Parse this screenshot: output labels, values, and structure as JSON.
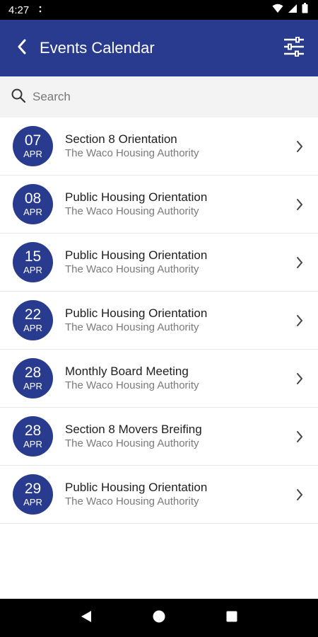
{
  "status_bar": {
    "time": "4:27",
    "notification_icon": "dots-icon",
    "icons": [
      "wifi-icon",
      "signal-icon",
      "battery-icon"
    ]
  },
  "app_bar": {
    "title": "Events Calendar",
    "back_icon": "back-arrow-icon",
    "filter_icon": "filter-sliders-icon",
    "color": "#293b8e"
  },
  "search": {
    "placeholder": "Search",
    "value": ""
  },
  "events": [
    {
      "day": "07",
      "month": "APR",
      "title": "Section 8 Orientation",
      "organization": "The Waco Housing Authority"
    },
    {
      "day": "08",
      "month": "APR",
      "title": "Public Housing Orientation",
      "organization": "The Waco Housing Authority"
    },
    {
      "day": "15",
      "month": "APR",
      "title": "Public Housing Orientation",
      "organization": "The Waco Housing Authority"
    },
    {
      "day": "22",
      "month": "APR",
      "title": "Public Housing Orientation",
      "organization": "The Waco Housing Authority"
    },
    {
      "day": "28",
      "month": "APR",
      "title": "Monthly Board Meeting",
      "organization": "The Waco Housing Authority"
    },
    {
      "day": "28",
      "month": "APR",
      "title": "Section 8 Movers Breifing",
      "organization": "The Waco Housing Authority"
    },
    {
      "day": "29",
      "month": "APR",
      "title": "Public Housing Orientation",
      "organization": "The Waco Housing Authority"
    }
  ],
  "nav_bar": {
    "icons": [
      "back-triangle-icon",
      "home-circle-icon",
      "recents-square-icon"
    ]
  }
}
